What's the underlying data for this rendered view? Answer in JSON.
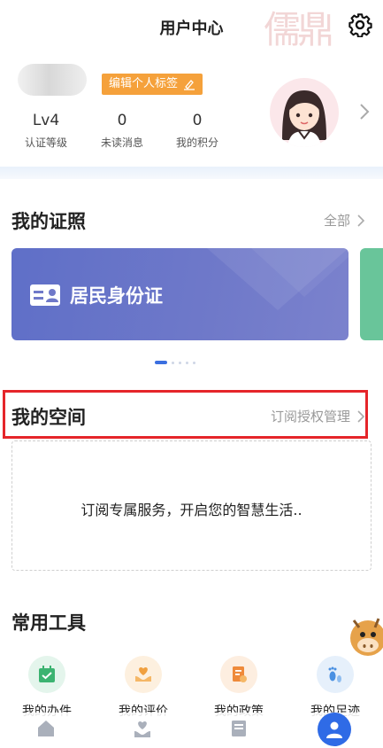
{
  "header": {
    "title": "用户中心",
    "watermark": "儒鼎"
  },
  "profile": {
    "edit_tag_label": "编辑个人标签",
    "stats": [
      {
        "value": "Lv4",
        "label": "认证等级"
      },
      {
        "value": "0",
        "label": "未读消息"
      },
      {
        "value": "0",
        "label": "我的积分"
      }
    ]
  },
  "licenses": {
    "title": "我的证照",
    "more_label": "全部",
    "card_label": "居民身份证"
  },
  "space": {
    "title": "我的空间",
    "more_label": "订阅授权管理",
    "empty_message": "订阅专属服务，开启您的智慧生活.."
  },
  "tools": {
    "title": "常用工具",
    "items": [
      {
        "label": "我的办件",
        "icon": "calendar-check-icon",
        "color": "#3cb371"
      },
      {
        "label": "我的评价",
        "icon": "heart-hand-icon",
        "color": "#f0a040"
      },
      {
        "label": "我的政策",
        "icon": "policy-doc-icon",
        "color": "#ef8a3a"
      },
      {
        "label": "我的足迹",
        "icon": "footprint-icon",
        "color": "#4a90e2"
      }
    ]
  },
  "colors": {
    "accent": "#2f6be6",
    "tag_orange": "#f5a13b",
    "highlight_red": "#e5252a",
    "card_blue": "#6f79c9"
  }
}
